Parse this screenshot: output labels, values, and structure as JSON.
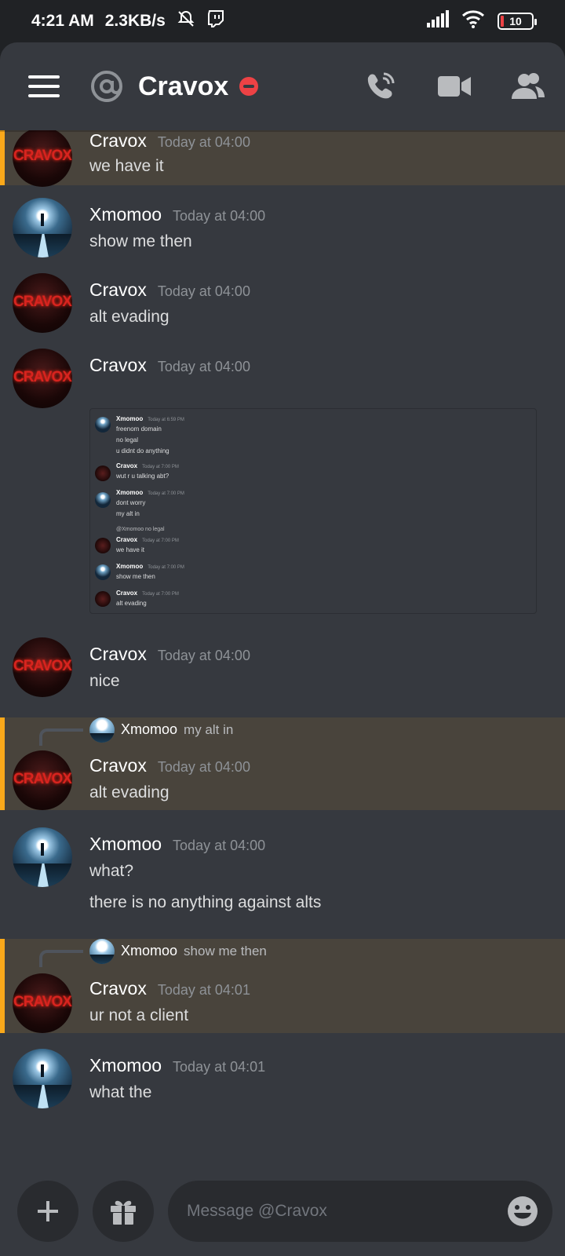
{
  "statusbar": {
    "time": "4:21 AM",
    "speed": "2.3KB/s",
    "battery": "10"
  },
  "header": {
    "title": "Cravox",
    "icons": [
      "hamburger-icon",
      "at-icon",
      "dnd-status-icon",
      "call-icon",
      "video-icon",
      "members-icon"
    ]
  },
  "messages": [
    {
      "author": "Cravox",
      "time": "Today at 04:00",
      "lines": [
        "we have it"
      ],
      "mention": true
    },
    {
      "author": "Xmomoo",
      "time": "Today at 04:00",
      "lines": [
        "show me then"
      ]
    },
    {
      "author": "Cravox",
      "time": "Today at 04:00",
      "lines": [
        "alt evading"
      ]
    },
    {
      "author": "Cravox",
      "time": "Today at 04:00",
      "lines": []
    },
    {
      "author": "Cravox",
      "time": "Today at 04:00",
      "lines": [
        "nice"
      ]
    },
    {
      "author": "Cravox",
      "time": "Today at 04:00",
      "lines": [
        "alt evading"
      ],
      "mention": true,
      "reply": {
        "author": "Xmomoo",
        "text": "my alt in"
      }
    },
    {
      "author": "Xmomoo",
      "time": "Today at 04:00",
      "lines": [
        "what?",
        "there is no anything against alts"
      ]
    },
    {
      "author": "Cravox",
      "time": "Today at 04:01",
      "lines": [
        "ur not a client"
      ],
      "mention": true,
      "reply": {
        "author": "Xmomoo",
        "text": "show me then"
      }
    },
    {
      "author": "Xmomoo",
      "time": "Today at 04:01",
      "lines": [
        "what the"
      ]
    }
  ],
  "embed": {
    "rows": [
      {
        "author": "Xmomoo",
        "time": "Today at 6:59 PM",
        "lines": [
          "freenom domain",
          "no legal",
          "u didnt do anything"
        ]
      },
      {
        "author": "Cravox",
        "time": "Today at 7:00 PM",
        "lines": [
          "wut r u talking abt?"
        ]
      },
      {
        "author": "Xmomoo",
        "time": "Today at 7:00 PM",
        "lines": [
          "dont worry",
          "my alt in"
        ]
      },
      {
        "author": "Cravox",
        "time": "Today at 7:00 PM",
        "lines": [
          "we have it"
        ],
        "reply": "@Xmomoo no legal"
      },
      {
        "author": "Xmomoo",
        "time": "Today at 7:00 PM",
        "lines": [
          "show me then"
        ]
      },
      {
        "author": "Cravox",
        "time": "Today at 7:00 PM",
        "lines": [
          "alt evading"
        ]
      }
    ]
  },
  "input": {
    "placeholder": "Message @Cravox"
  },
  "colors": {
    "background": "#36393f",
    "mention_bg": "#49443c",
    "mention_border": "#faa81a",
    "dnd_red": "#ed4245"
  }
}
